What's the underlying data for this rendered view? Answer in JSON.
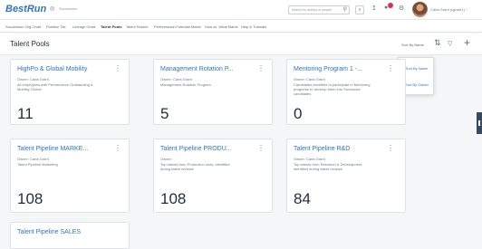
{
  "topbar": {
    "logo": "BestRun",
    "home_label": "Succession",
    "search_placeholder": "Search for actions or people",
    "dropdown_label": "v",
    "user_name": "Carla Grant (cgrant1) ~"
  },
  "navbar": {
    "items": [
      {
        "label": "Succession Org Chart"
      },
      {
        "label": "Position Tile"
      },
      {
        "label": "Lineage Chart"
      },
      {
        "label": "Talent Pools"
      },
      {
        "label": "Talent Search"
      },
      {
        "label": "Performance-Potential Matrix"
      },
      {
        "label": "How vs. What Matrix"
      },
      {
        "label": "Help & Tutorials"
      }
    ],
    "active_index": 3
  },
  "page": {
    "title": "Talent Pools",
    "sort_label": "Sort By Name"
  },
  "sort_menu": {
    "items": [
      "Sort By Name",
      "Sort By Owner"
    ]
  },
  "cards": [
    {
      "title": "HighPo & Global Mobility",
      "owner": "Owner: Carla Grant",
      "desc1": "All employees with Performance Outstanding &",
      "desc2": "Mobility-Global",
      "count": "11"
    },
    {
      "title": "Management Rotation P...",
      "owner": "Owner: Carla Grant",
      "desc1": "Management Rotation Program",
      "desc2": "",
      "count": "5"
    },
    {
      "title": "Mentoring Program 1 -...",
      "owner": "Owner: Carla Grant",
      "desc1": "Candidates identified to participate in Mentoring",
      "desc2": "programs to develop them into Successor",
      "desc3": "candidates",
      "count": "0"
    },
    {
      "title": "Talent Pipeline MARKE...",
      "owner": "Owner: Carla Grant",
      "desc1": "Talent Pipeline Marketing",
      "desc2": "",
      "count": "108"
    },
    {
      "title": "Talent Pipeline PRODU...",
      "owner": "Owner:",
      "desc1": "Top talents from Production units, identified",
      "desc2": "during talent reviews",
      "count": "108"
    },
    {
      "title": "Talent Pipeline R&D",
      "owner": "Owner: Carla Grant",
      "desc1": "Top talents from Research & Development,",
      "desc2": "identified during talent reviews",
      "count": "84"
    },
    {
      "title": "Talent Pipeline SALES",
      "owner": "",
      "desc1": "",
      "desc2": "",
      "count": ""
    }
  ],
  "colors": {
    "accent": "#2f73c6",
    "text_dark": "#1d2d3e",
    "badge": "#d9334a"
  },
  "icons": [
    "home-icon",
    "search-icon",
    "help-icon",
    "notifications-icon",
    "settings-icon",
    "sort-icon",
    "filter-icon",
    "add-icon",
    "more-options-icon"
  ]
}
